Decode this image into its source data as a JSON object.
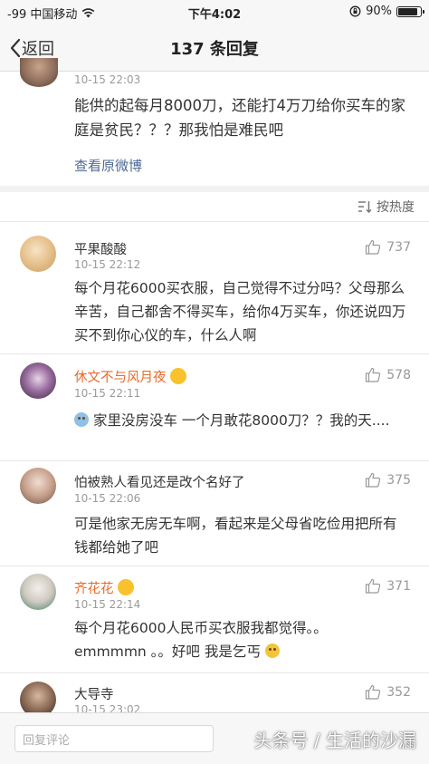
{
  "status_bar": {
    "carrier": "-99 中国移动",
    "time": "下午4:02",
    "battery": "90%",
    "battery_level": 0.9
  },
  "nav": {
    "back_label": "返回",
    "title": "137 条回复"
  },
  "origin": {
    "time": "10-15 22:03",
    "text": "能供的起每月8000刀，还能打4万刀给你买车的家庭是贫民？？？那我怕是难民吧",
    "link": "查看原微博"
  },
  "sort_label": "按热度",
  "comments": [
    {
      "name": "平果酸酸",
      "time": "10-15 22:12",
      "text": "每个月花6000买衣服，自己觉得不过分吗？父母那么辛苦，自己都舍不得买车，给你4万买车，你还说四万买不到你心仪的车，什么人啊",
      "likes": "737"
    },
    {
      "name": "休文不与风月夜",
      "time": "10-15 22:11",
      "text": "家里没房没车 一个月敢花8000刀？？我的天....",
      "likes": "578"
    },
    {
      "name": "怕被熟人看见还是改个名好了",
      "time": "10-15 22:06",
      "text": "可是他家无房无车啊，看起来是父母省吃俭用把所有钱都给她了吧",
      "likes": "375"
    },
    {
      "name": "齐花花",
      "time": "10-15 22:14",
      "text_line1": "每个月花6000人民币买衣服我都觉得。。",
      "text_line2": "emmmmn 。。好吧 我是乞丐",
      "likes": "371"
    },
    {
      "name": "大导寺",
      "time": "10-15 23:02",
      "likes": "352"
    }
  ],
  "reply": {
    "placeholder": "回复评论"
  },
  "watermark": "头条号 / 生活的沙漏",
  "colors": {
    "link": "#506a96",
    "vip_name": "#e86a2b",
    "meta": "#9a9a9a"
  }
}
